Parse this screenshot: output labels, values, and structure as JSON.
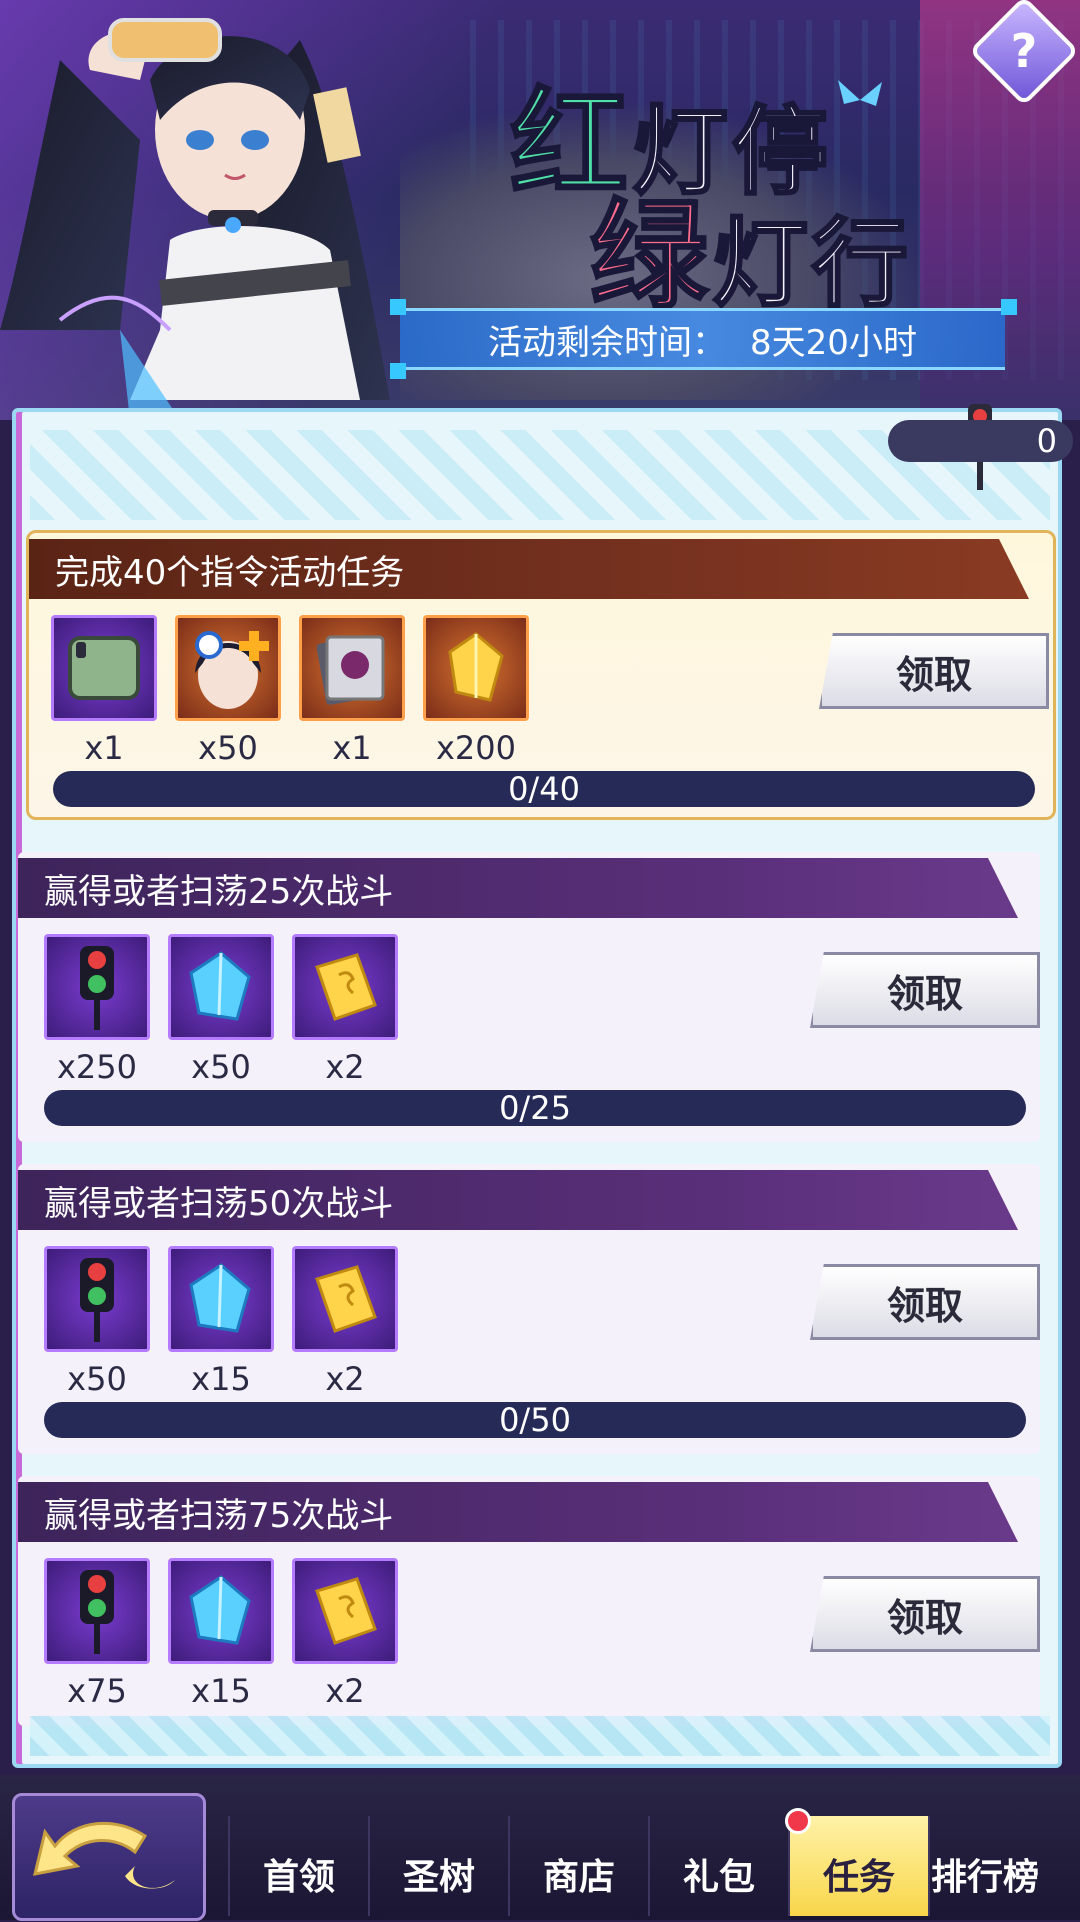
{
  "header": {
    "title_line1_a": "红",
    "title_line1_b": "灯停",
    "title_line2_a": "绿",
    "title_line2_b": "灯行",
    "timer_label": "活动剩余时间：",
    "timer_value": "8天20小时",
    "help_label": "?"
  },
  "counter": {
    "value": "0",
    "icon": "traffic-light-icon"
  },
  "tasks": [
    {
      "title": "完成40个指令活动任务",
      "featured": true,
      "rewards": [
        {
          "icon": "frame-item-icon",
          "qty": "x1"
        },
        {
          "icon": "character-fragment-icon",
          "qty": "x50"
        },
        {
          "icon": "card-pack-icon",
          "qty": "x1"
        },
        {
          "icon": "gold-crystal-icon",
          "qty": "x200"
        }
      ],
      "progress": "0/40",
      "button": "领取"
    },
    {
      "title": "赢得或者扫荡25次战斗",
      "rewards": [
        {
          "icon": "traffic-light-token-icon",
          "qty": "x250"
        },
        {
          "icon": "blue-crystal-icon",
          "qty": "x50"
        },
        {
          "icon": "gold-ticket-icon",
          "qty": "x2"
        }
      ],
      "progress": "0/25",
      "button": "领取"
    },
    {
      "title": "赢得或者扫荡50次战斗",
      "rewards": [
        {
          "icon": "traffic-light-token-icon",
          "qty": "x50"
        },
        {
          "icon": "blue-crystal-icon",
          "qty": "x15"
        },
        {
          "icon": "gold-ticket-icon",
          "qty": "x2"
        }
      ],
      "progress": "0/50",
      "button": "领取"
    },
    {
      "title": "赢得或者扫荡75次战斗",
      "rewards": [
        {
          "icon": "traffic-light-token-icon",
          "qty": "x75"
        },
        {
          "icon": "blue-crystal-icon",
          "qty": "x15"
        },
        {
          "icon": "gold-ticket-icon",
          "qty": "x2"
        }
      ],
      "button": "领取"
    }
  ],
  "nav": {
    "back_icon": "back-arrow-icon",
    "tabs": [
      {
        "label": "首领"
      },
      {
        "label": "圣树"
      },
      {
        "label": "商店"
      },
      {
        "label": "礼包"
      },
      {
        "label": "任务",
        "active": true
      },
      {
        "label": "排行榜"
      }
    ]
  },
  "colors": {
    "accent_purple": "#5a2f7a",
    "featured_header": "#7a3320",
    "progress_bar": "#262a56",
    "active_tab": "#f8d64a"
  }
}
